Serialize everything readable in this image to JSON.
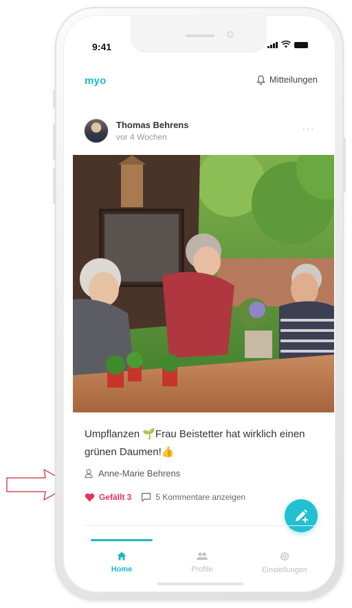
{
  "status_bar": {
    "time": "9:41"
  },
  "header": {
    "app_name": "myo",
    "notifications_label": "Mitteilungen"
  },
  "post": {
    "author": "Thomas Behrens",
    "time_ago": "vor 4 Wochen",
    "more_label": "···",
    "text_before": "Umpflanzen ",
    "emoji_sprout": "🌱",
    "text_after": "Frau Beistetter hat wirklich einen grünen Daumen!",
    "emoji_thumb": "👍",
    "tagged_person": "Anne-Marie Behrens",
    "like_label": "Gefällt 3",
    "comments_label": "5 Kommentare anzeigen"
  },
  "tabbar": {
    "items": [
      {
        "label": "Home",
        "icon": "home-icon",
        "active": true
      },
      {
        "label": "Profile",
        "icon": "people-icon",
        "active": false
      },
      {
        "label": "Einstellungen",
        "icon": "gear-icon",
        "active": false
      }
    ]
  },
  "colors": {
    "accent": "#1ab8c9",
    "like": "#e53557",
    "fab": "#22c0d0"
  }
}
